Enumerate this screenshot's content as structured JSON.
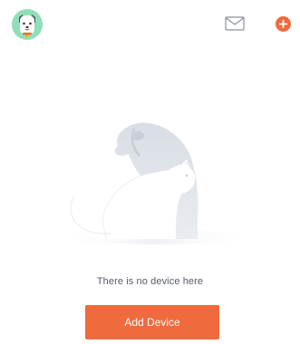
{
  "header": {
    "avatar_icon": "dog-avatar-icon",
    "mail_icon": "envelope-icon",
    "add_icon": "plus-circle-icon"
  },
  "empty_state": {
    "illustration": "dog-and-cat-silhouette",
    "message": "There is no device here"
  },
  "actions": {
    "add_device_label": "Add Device"
  },
  "colors": {
    "accent": "#ef6a3d",
    "avatar_bg": "#8fdfb8",
    "text": "#555b66",
    "illustration_dog": "#dfe3ea",
    "illustration_cat": "#ffffff"
  }
}
